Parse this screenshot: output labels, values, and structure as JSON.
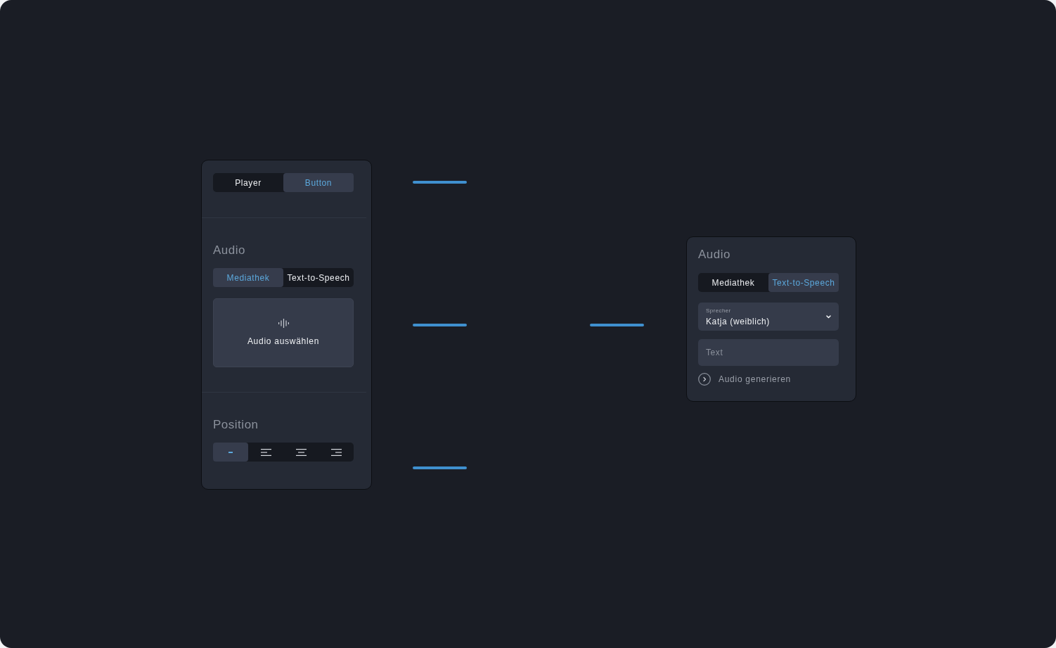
{
  "left_panel": {
    "mode_tabs": [
      {
        "label": "Player",
        "selected": false
      },
      {
        "label": "Button",
        "selected": true
      }
    ],
    "audio_section": {
      "title": "Audio",
      "source_tabs": [
        {
          "label": "Mediathek",
          "selected": true
        },
        {
          "label": "Text-to-Speech",
          "selected": false
        }
      ],
      "select_audio": {
        "label": "Audio auswählen"
      }
    },
    "position_section": {
      "title": "Position",
      "options": [
        {
          "kind": "none",
          "selected": true
        },
        {
          "kind": "left",
          "selected": false
        },
        {
          "kind": "center",
          "selected": false
        },
        {
          "kind": "right",
          "selected": false
        }
      ]
    }
  },
  "right_panel": {
    "title": "Audio",
    "source_tabs": [
      {
        "label": "Mediathek",
        "selected": false
      },
      {
        "label": "Text-to-Speech",
        "selected": true
      }
    ],
    "speaker_select": {
      "label": "Sprecher",
      "value": "Katja (weiblich)"
    },
    "text_field": {
      "placeholder": "Text"
    },
    "generate_action": {
      "label": "Audio generieren"
    }
  }
}
